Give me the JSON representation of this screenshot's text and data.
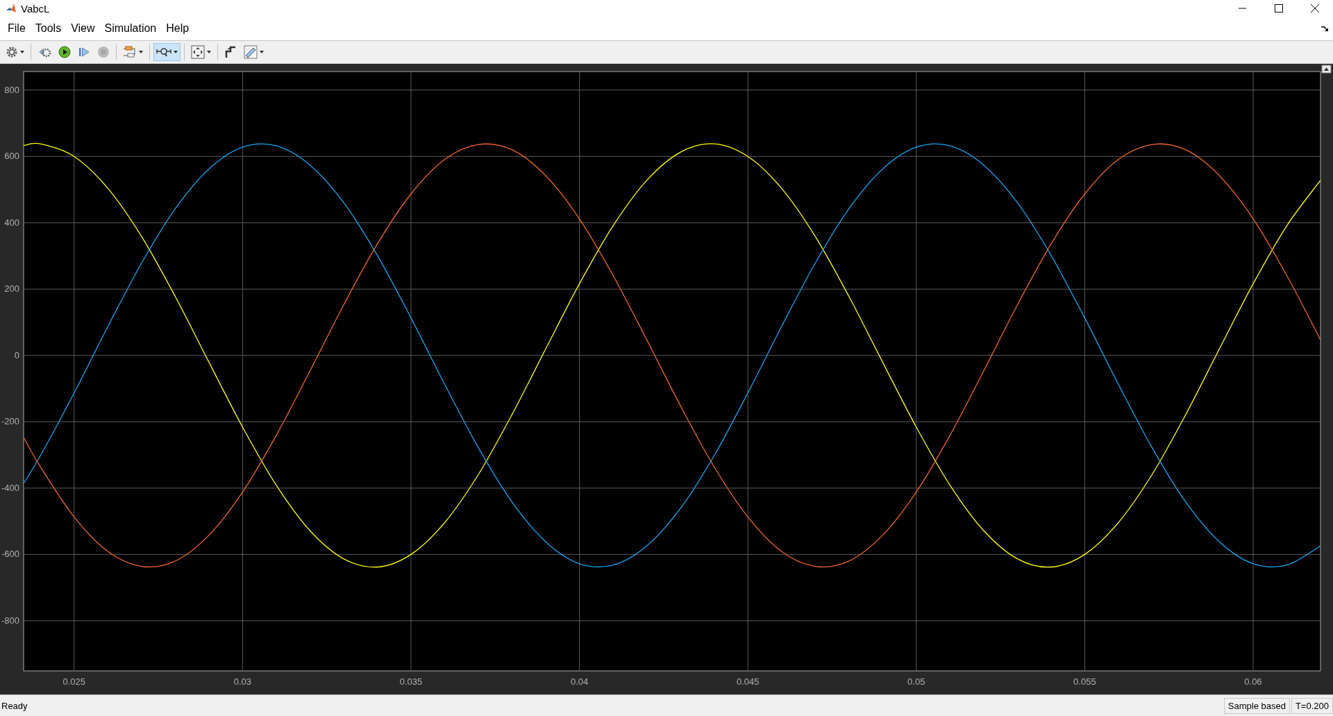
{
  "window": {
    "title": "VabcL"
  },
  "menu": [
    {
      "label": "File"
    },
    {
      "label": "Tools"
    },
    {
      "label": "View"
    },
    {
      "label": "Simulation"
    },
    {
      "label": "Help"
    }
  ],
  "toolbar": [
    {
      "kind": "settings",
      "dropdown": true,
      "selected": false,
      "disabled": false
    },
    {
      "kind": "step-back",
      "dropdown": false,
      "selected": false,
      "disabled": false
    },
    {
      "kind": "run",
      "dropdown": false,
      "selected": false,
      "disabled": false
    },
    {
      "kind": "step-forward",
      "dropdown": false,
      "selected": false,
      "disabled": false
    },
    {
      "kind": "stop",
      "dropdown": false,
      "selected": false,
      "disabled": true
    },
    {
      "kind": "signals",
      "dropdown": true,
      "selected": false,
      "disabled": false
    },
    {
      "kind": "zoom",
      "dropdown": true,
      "selected": true,
      "disabled": false
    },
    {
      "kind": "fit",
      "dropdown": true,
      "selected": false,
      "disabled": false
    },
    {
      "kind": "trigger",
      "dropdown": false,
      "selected": false,
      "disabled": false
    },
    {
      "kind": "measure",
      "dropdown": true,
      "selected": false,
      "disabled": false
    }
  ],
  "scope": {
    "chart_data": {
      "type": "line",
      "x": [
        0.0235,
        0.024,
        0.025,
        0.026,
        0.027,
        0.028,
        0.029,
        0.03,
        0.031,
        0.032,
        0.033,
        0.034,
        0.035,
        0.036,
        0.037,
        0.038,
        0.039,
        0.04,
        0.041,
        0.042,
        0.043,
        0.044,
        0.045,
        0.046,
        0.047,
        0.048,
        0.049,
        0.05,
        0.051,
        0.052,
        0.053,
        0.054,
        0.055,
        0.056,
        0.057,
        0.058,
        0.059,
        0.06,
        0.061,
        0.062
      ],
      "series": [
        {
          "color": "#ffff00",
          "values": [
            633,
            638,
            600,
            504,
            359,
            178,
            -20,
            -216,
            -391,
            -528,
            -613,
            -638,
            -600,
            -504,
            -359,
            -178,
            20,
            216,
            391,
            528,
            613,
            638,
            600,
            504,
            359,
            178,
            -20,
            -216,
            -391,
            -528,
            -613,
            -638,
            -600,
            -504,
            -359,
            -178,
            20,
            216,
            391,
            528
          ]
        },
        {
          "color": "#16a4f2",
          "values": [
            -386,
            -302,
            -113,
            87,
            278,
            442,
            562,
            628,
            632,
            574,
            461,
            302,
            113,
            -87,
            -278,
            -442,
            -562,
            -628,
            -632,
            -574,
            -461,
            -302,
            -113,
            87,
            278,
            442,
            562,
            628,
            632,
            574,
            461,
            302,
            113,
            -87,
            -278,
            -442,
            -562,
            -628,
            -632,
            -574
          ]
        },
        {
          "color": "#f2662a",
          "values": [
            -247,
            -336,
            -487,
            -591,
            -636,
            -620,
            -542,
            -412,
            -241,
            -47,
            152,
            336,
            487,
            591,
            636,
            620,
            542,
            412,
            241,
            47,
            -152,
            -336,
            -487,
            -591,
            -636,
            -620,
            -542,
            -412,
            -241,
            -47,
            152,
            336,
            487,
            591,
            636,
            620,
            542,
            412,
            241,
            47
          ]
        }
      ],
      "xlim": [
        0.0235,
        0.062
      ],
      "ylim": [
        -951,
        856
      ],
      "grid": true,
      "xticks": [
        0.025,
        0.03,
        0.035,
        0.04,
        0.045,
        0.05,
        0.055,
        0.06
      ],
      "yticks": [
        -800,
        -600,
        -400,
        -200,
        0,
        200,
        400,
        600,
        800
      ]
    }
  },
  "status_bar": {
    "message": "Ready",
    "mode": "Sample based",
    "time": "T=0.200"
  }
}
